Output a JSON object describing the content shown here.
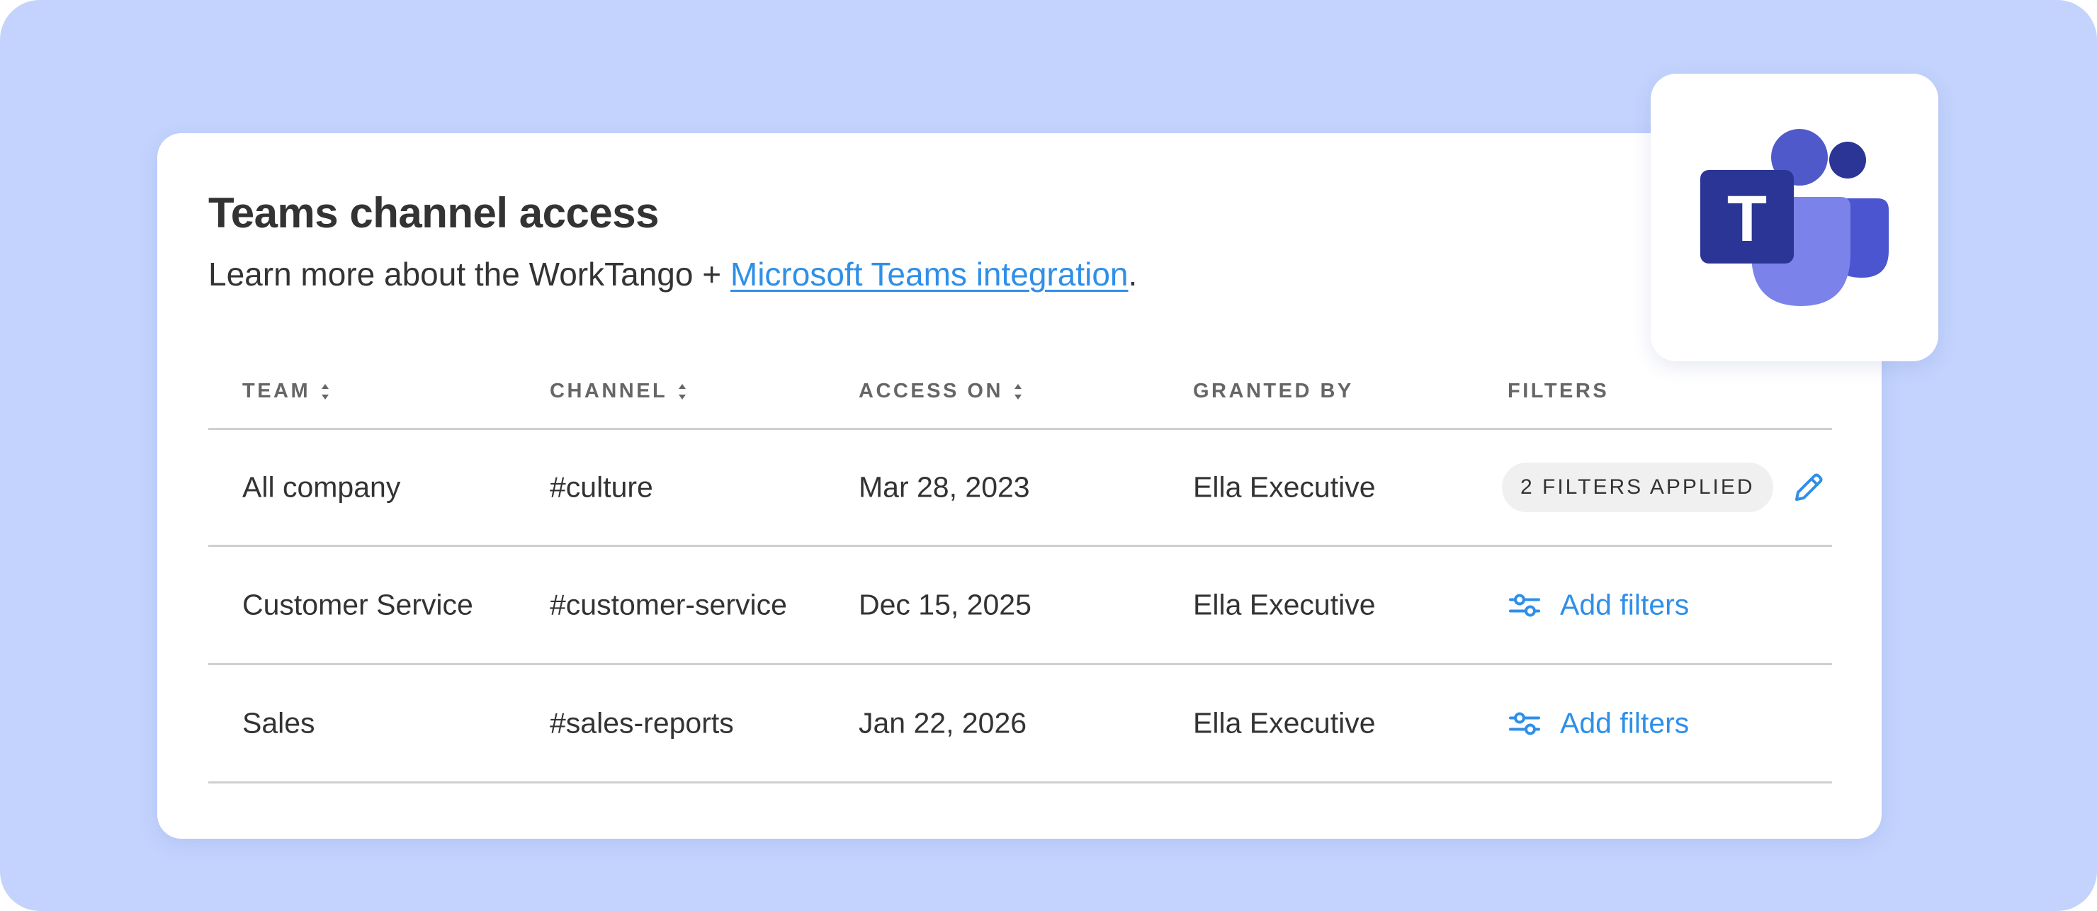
{
  "card": {
    "title": "Teams channel access",
    "subtitle_prefix": "Learn more about the WorkTango + ",
    "subtitle_link": "Microsoft Teams integration",
    "subtitle_suffix": "."
  },
  "table": {
    "headers": {
      "team": "TEAM",
      "channel": "CHANNEL",
      "access_on": "ACCESS ON",
      "granted_by": "GRANTED BY",
      "filters": "FILTERS"
    },
    "rows": [
      {
        "team": "All company",
        "channel": "#culture",
        "access_on": "Mar 28, 2023",
        "granted_by": "Ella Executive",
        "filters_badge": "2 FILTERS APPLIED"
      },
      {
        "team": "Customer Service",
        "channel": "#customer-service",
        "access_on": "Dec 15, 2025",
        "granted_by": "Ella Executive",
        "filters_action": "Add filters"
      },
      {
        "team": "Sales",
        "channel": "#sales-reports",
        "access_on": "Jan 22, 2026",
        "granted_by": "Ella Executive",
        "filters_action": "Add filters"
      }
    ]
  },
  "logo": {
    "letter": "T",
    "icon": "microsoft-teams-logo"
  },
  "colors": {
    "background": "#c3d3fd",
    "link": "#2f8fe8",
    "text": "#333333",
    "header_text": "#666666",
    "teams_dark": "#2b3595",
    "teams_mid": "#5059c9",
    "teams_light": "#7b83eb"
  }
}
